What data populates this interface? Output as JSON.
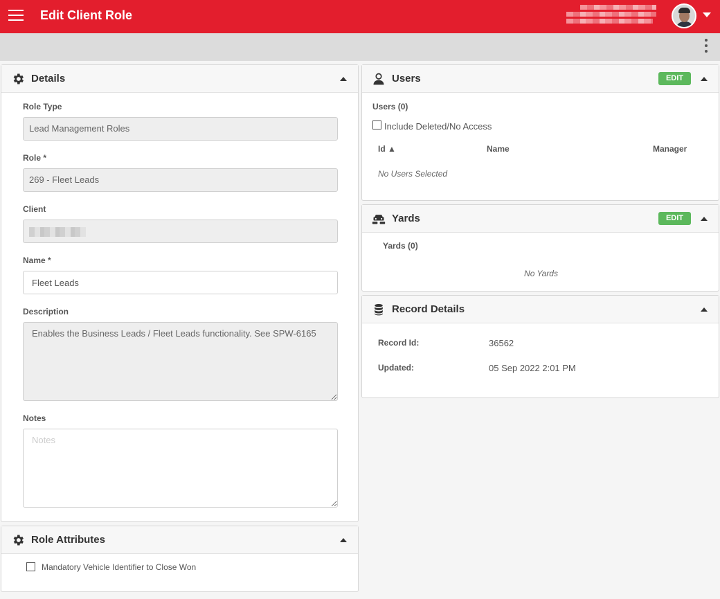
{
  "header": {
    "title": "Edit Client Role"
  },
  "details": {
    "title": "Details",
    "role_type_label": "Role Type",
    "role_type_value": "Lead Management Roles",
    "role_label": "Role *",
    "role_value": "269 - Fleet Leads",
    "client_label": "Client",
    "name_label": "Name *",
    "name_value": "Fleet Leads",
    "description_label": "Description",
    "description_value": "Enables the Business Leads / Fleet Leads functionality. See SPW-6165",
    "notes_label": "Notes",
    "notes_placeholder": "Notes"
  },
  "role_attributes": {
    "title": "Role Attributes",
    "items": [
      {
        "label": "Mandatory Vehicle Identifier to Close Won",
        "checked": false
      }
    ]
  },
  "users": {
    "title": "Users",
    "edit_label": "EDIT",
    "count_label": "Users (0)",
    "include_deleted_label": "Include Deleted/No Access",
    "columns": [
      "Id ▲",
      "Name",
      "Manager"
    ],
    "empty_text": "No Users Selected"
  },
  "yards": {
    "title": "Yards",
    "edit_label": "EDIT",
    "count_label": "Yards (0)",
    "empty_text": "No Yards"
  },
  "record_details": {
    "title": "Record Details",
    "record_id_label": "Record Id:",
    "record_id_value": "36562",
    "updated_label": "Updated:",
    "updated_value": "05 Sep 2022 2:01 PM"
  },
  "colors": {
    "brand_red": "#e31e2d",
    "edit_green": "#5cb85c"
  },
  "icons": {
    "menu": "hamburger-menu-icon",
    "details": "gear-icon",
    "users": "user-icon",
    "yards": "yards-icon",
    "record": "database-icon"
  }
}
